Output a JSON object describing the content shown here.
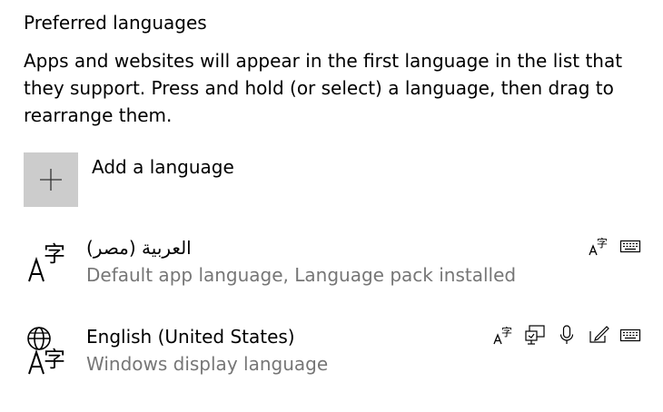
{
  "section": {
    "title": "Preferred languages",
    "description": "Apps and websites will appear in the first language in the list that they support. Press and hold (or select) a language, then drag to rearrange them."
  },
  "add_language": {
    "label": "Add a language",
    "icon": "plus-icon"
  },
  "languages": [
    {
      "name": "العربية (مصر)",
      "description": "Default app language, Language pack installed",
      "icon": "language-icon",
      "features": [
        "language-pack-icon",
        "keyboard-icon"
      ]
    },
    {
      "name": "English (United States)",
      "description": "Windows display language",
      "icon": "display-language-icon",
      "features": [
        "language-pack-icon",
        "text-to-speech-icon",
        "speech-recognition-icon",
        "handwriting-icon",
        "keyboard-icon"
      ]
    }
  ],
  "colors": {
    "text": "#000000",
    "secondary_text": "#767676",
    "tile": "#cccccc"
  }
}
